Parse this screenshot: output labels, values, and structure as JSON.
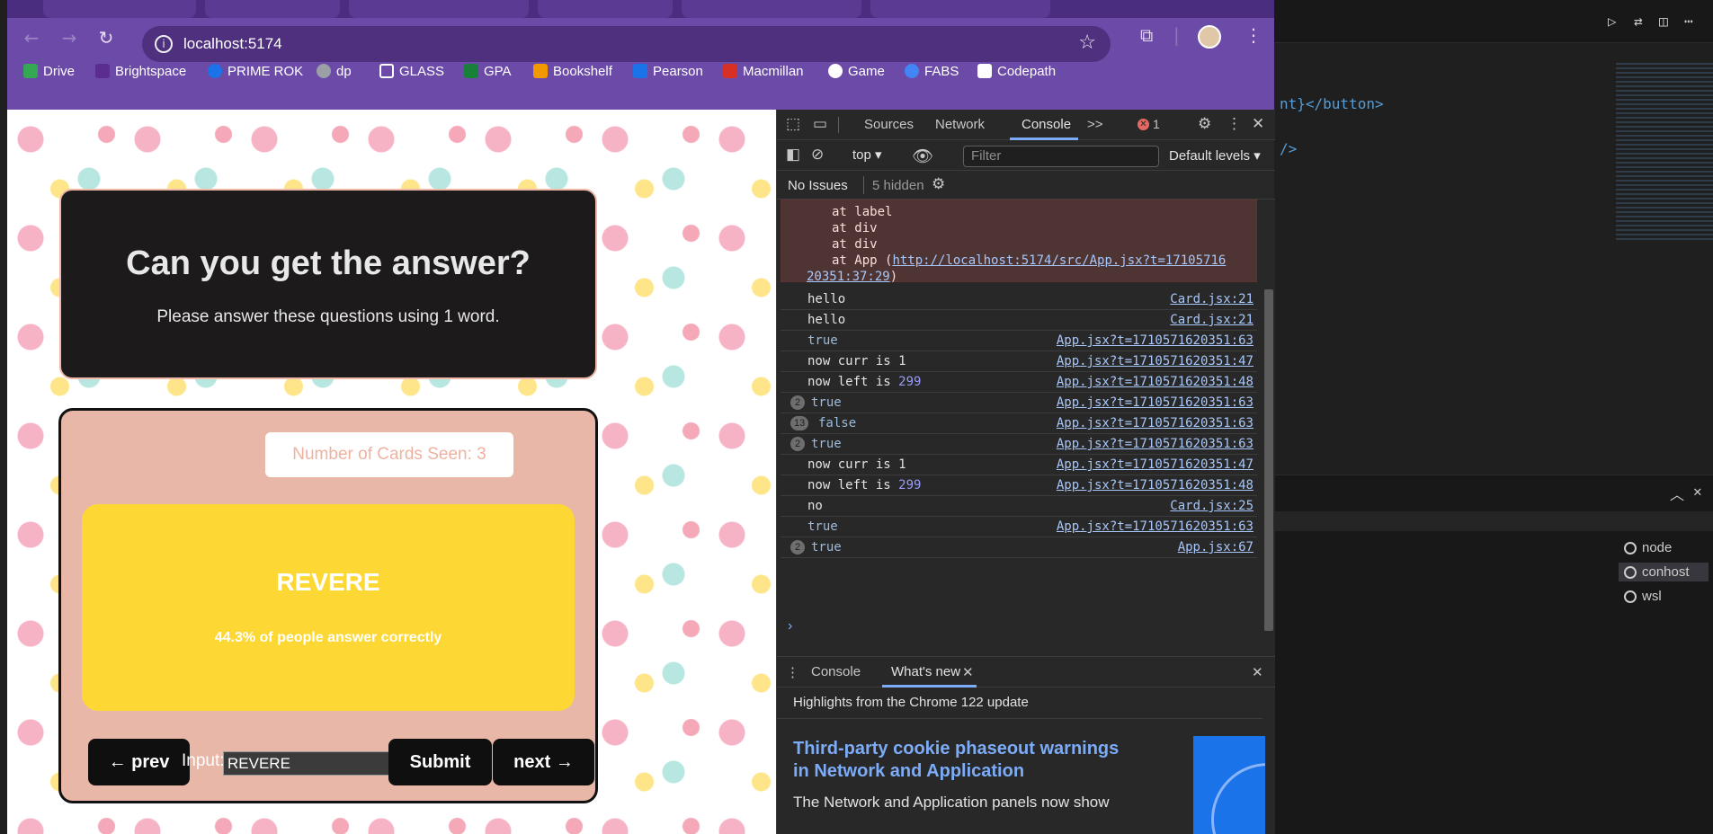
{
  "browser": {
    "url": "localhost:5174",
    "bookmarks": [
      {
        "label": "Drive",
        "color": "#34a853"
      },
      {
        "label": "Brightspace",
        "color": "#5c2d91"
      },
      {
        "label": "PRIME ROK",
        "color": "#1a73e8"
      },
      {
        "label": "dp",
        "color": "#9aa0a6"
      },
      {
        "label": "GLASS",
        "color": "transparent"
      },
      {
        "label": "GPA",
        "color": "#188038"
      },
      {
        "label": "Bookshelf",
        "color": "#f29900"
      },
      {
        "label": "Pearson",
        "color": "#1a73e8"
      },
      {
        "label": "Macmillan",
        "color": "#d93025"
      },
      {
        "label": "Game",
        "color": "#ffffff"
      },
      {
        "label": "FABS",
        "color": "#4285f4"
      },
      {
        "label": "Codepath",
        "color": "#ffffff"
      }
    ]
  },
  "app": {
    "title": "Can you get the answer?",
    "subtitle": "Please answer these questions using 1 word.",
    "cards_seen": "Number of Cards Seen: 3",
    "card_word": "REVERE",
    "card_stat": "44.3% of people answer correctly",
    "prev_label": "← prev",
    "input_label": "Input:",
    "input_value": "REVERE",
    "submit_label": "Submit",
    "next_label": "next →"
  },
  "devtools": {
    "tabs": [
      "Sources",
      "Network",
      "Console"
    ],
    "more": ">>",
    "error_count": "1",
    "context": "top",
    "filter_placeholder": "Filter",
    "levels": "Default levels",
    "issues": "No Issues",
    "hidden": "5 hidden",
    "error_lines": [
      "at label",
      "at div",
      "at div"
    ],
    "error_app_prefix": "at App (",
    "error_app_link": "http://localhost:5174/src/App.jsx?t=17105716",
    "error_app_link2": "20351:37:29",
    "error_app_suffix": ")",
    "logs": [
      {
        "count": "",
        "msg": "hello",
        "num": "",
        "bool": false,
        "src": "Card.jsx:21"
      },
      {
        "count": "",
        "msg": "hello",
        "num": "",
        "bool": false,
        "src": "Card.jsx:21"
      },
      {
        "count": "",
        "msg": "true",
        "num": "",
        "bool": true,
        "src": "App.jsx?t=1710571620351:63"
      },
      {
        "count": "",
        "msg": "now curr is 1",
        "num": "",
        "bool": false,
        "src": "App.jsx?t=1710571620351:47"
      },
      {
        "count": "",
        "msg": "now left is ",
        "num": "299",
        "bool": false,
        "src": "App.jsx?t=1710571620351:48"
      },
      {
        "count": "2",
        "msg": "true",
        "num": "",
        "bool": true,
        "src": "App.jsx?t=1710571620351:63"
      },
      {
        "count": "13",
        "msg": "false",
        "num": "",
        "bool": true,
        "src": "App.jsx?t=1710571620351:63"
      },
      {
        "count": "2",
        "msg": "true",
        "num": "",
        "bool": true,
        "src": "App.jsx?t=1710571620351:63"
      },
      {
        "count": "",
        "msg": "now curr is 1",
        "num": "",
        "bool": false,
        "src": "App.jsx?t=1710571620351:47"
      },
      {
        "count": "",
        "msg": "now left is ",
        "num": "299",
        "bool": false,
        "src": "App.jsx?t=1710571620351:48"
      },
      {
        "count": "",
        "msg": "no",
        "num": "",
        "bool": false,
        "src": "Card.jsx:25"
      },
      {
        "count": "",
        "msg": "true",
        "num": "",
        "bool": true,
        "src": "App.jsx?t=1710571620351:63"
      },
      {
        "count": "2",
        "msg": "true",
        "num": "",
        "bool": true,
        "src": "App.jsx:67"
      }
    ],
    "drawer_tabs": [
      "Console",
      "What's new"
    ],
    "highlights": "Highlights from the Chrome 122 update",
    "whatsnew_heading": "Third-party cookie phaseout warnings in Network and Application",
    "whatsnew_text": "The Network and Application panels now show"
  },
  "vscode": {
    "code_line1": "nt}</button>",
    "code_line2": "/>",
    "terminals": [
      "node",
      "conhost",
      "wsl"
    ]
  }
}
